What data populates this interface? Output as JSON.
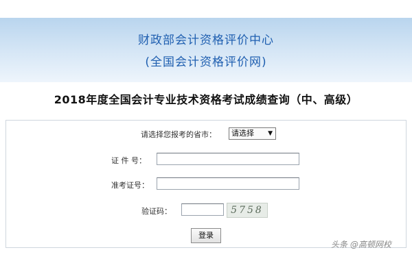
{
  "header": {
    "org_name": "财政部会计资格评价中心",
    "org_site": "(全国会计资格评价网)"
  },
  "page": {
    "title": "2018年度全国会计专业技术资格考试成绩查询（中、高级）"
  },
  "form": {
    "province_label": "请选择您报考的省市：",
    "province_select_value": "请选择",
    "id_label": "证 件 号：",
    "id_value": "",
    "ticket_label": "准考证号：",
    "ticket_value": "",
    "captcha_label": "验证码：",
    "captcha_value": "",
    "captcha_code": "5758",
    "login_label": "登录"
  },
  "watermark": {
    "text": "头条 @高顿网校"
  }
}
